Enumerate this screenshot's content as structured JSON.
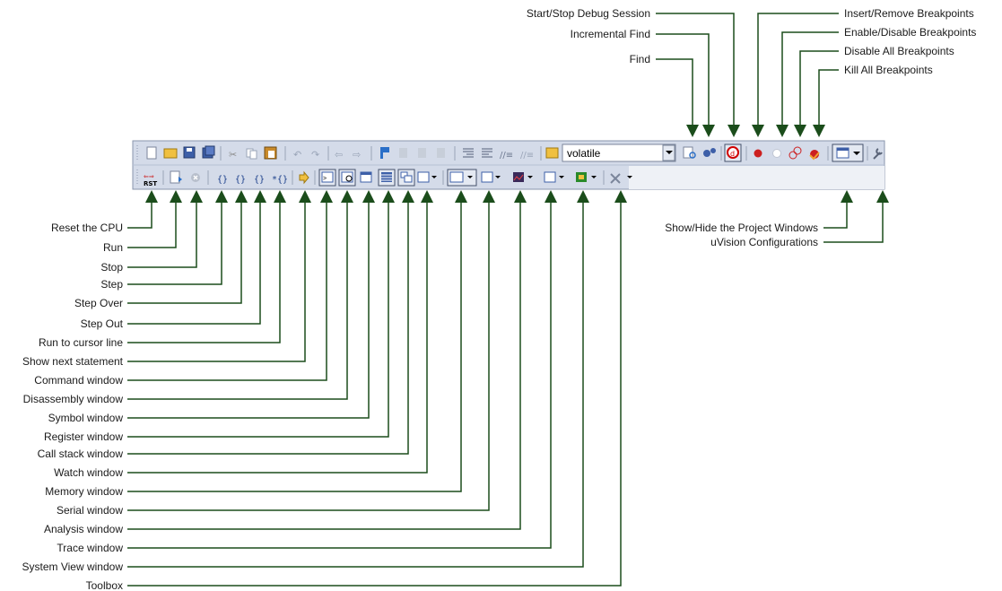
{
  "toolbar": {
    "search_value": "volatile"
  },
  "labels": {
    "top": [
      "Start/Stop Debug Session",
      "Incremental Find",
      "Find",
      "Insert/Remove Breakpoints",
      "Enable/Disable Breakpoints",
      "Disable All Breakpoints",
      "Kill All Breakpoints"
    ],
    "right": [
      "Show/Hide the Project Windows",
      "uVision Configurations"
    ],
    "left": [
      "Reset the CPU",
      "Run",
      "Stop",
      "Step",
      "Step Over",
      "Step Out",
      "Run to cursor line",
      "Show next statement",
      "Command window",
      "Disassembly window",
      "Symbol window",
      "Register window",
      "Call stack window",
      "Watch window",
      "Memory window",
      "Serial window",
      "Analysis window",
      "Trace window",
      "System View window",
      "Toolbox"
    ]
  },
  "colors": {
    "wire": "#1b4d1b",
    "toolbar_bg": "#d4dbe9",
    "toolbar_border": "#8a96ad",
    "breakpoint_red": "#cc1f1f",
    "debug_active": "#d00000"
  }
}
